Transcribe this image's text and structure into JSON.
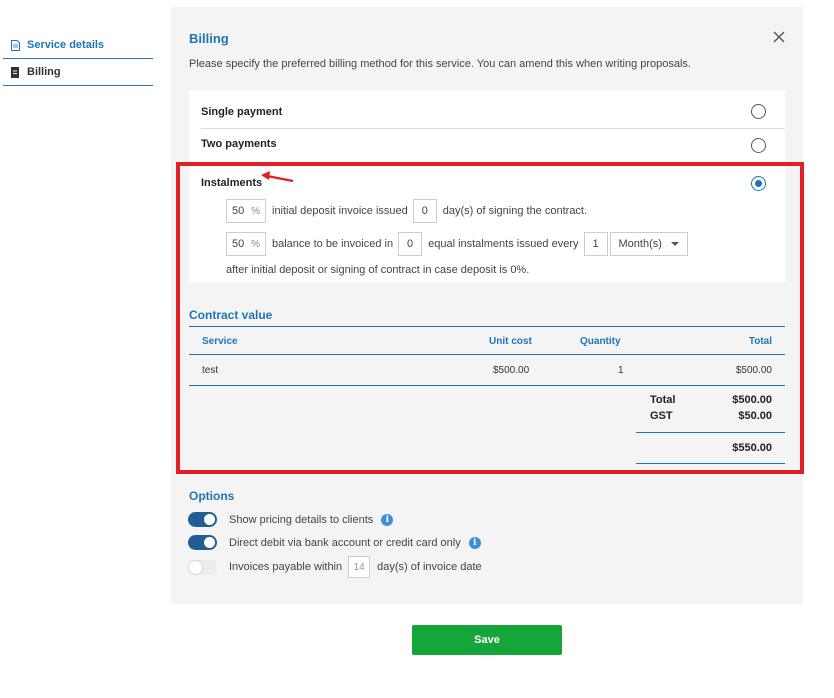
{
  "sidebar": {
    "items": [
      {
        "label": "Service details",
        "icon": "document-icon"
      },
      {
        "label": "Billing",
        "icon": "bill-icon"
      }
    ]
  },
  "billing": {
    "title": "Billing",
    "intro": "Please specify the preferred billing method for this service. You can amend this when writing proposals.",
    "options": [
      {
        "label": "Single payment",
        "selected": false
      },
      {
        "label": "Two payments",
        "selected": false
      },
      {
        "label": "Instalments",
        "selected": true
      }
    ],
    "instalments": {
      "deposit_pct": "50",
      "pct_symbol": "%",
      "deposit_text": "initial deposit invoice issued",
      "deposit_days": "0",
      "deposit_suffix": "day(s) of signing the contract.",
      "balance_pct": "50",
      "balance_text": "balance to be invoiced in",
      "balance_count": "0",
      "balance_mid": "equal instalments issued every",
      "interval": "1",
      "interval_unit": "Month(s)",
      "note": "after initial deposit or signing of contract in case deposit is 0%."
    }
  },
  "contract": {
    "title": "Contract value",
    "columns": [
      "Service",
      "Unit cost",
      "Quantity",
      "Total"
    ],
    "rows": [
      {
        "service": "test",
        "unit_cost": "$500.00",
        "quantity": "1",
        "total": "$500.00"
      }
    ],
    "total_label": "Total",
    "total_value": "$500.00",
    "gst_label": "GST",
    "gst_value": "$50.00",
    "grand_total": "$550.00"
  },
  "options": {
    "title": "Options",
    "toggles": [
      {
        "label": "Show pricing details to clients",
        "on": true,
        "info": true
      },
      {
        "label": "Direct debit via bank account or credit card only",
        "on": true,
        "info": true
      },
      {
        "label_before": "Invoices payable within",
        "value": "14",
        "label_after": "day(s) of invoice date",
        "on": false
      }
    ]
  },
  "save_label": "Save",
  "colors": {
    "accent": "#1f74b8",
    "highlight": "#e31e24",
    "save": "#16a53a"
  }
}
